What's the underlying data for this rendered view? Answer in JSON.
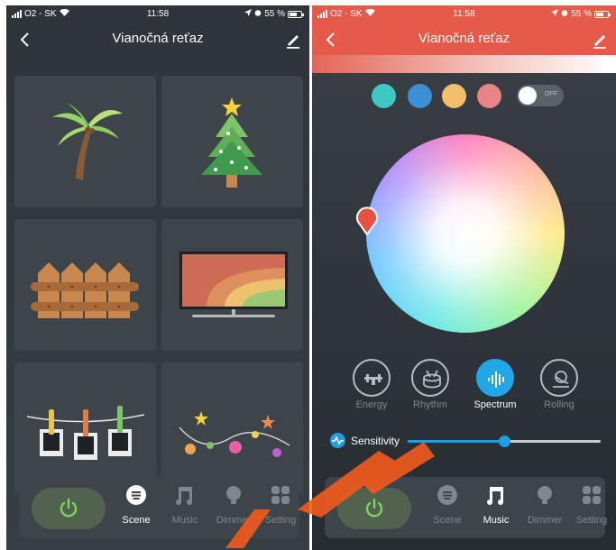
{
  "left_screen": {
    "status": {
      "carrier": "O2 - SK",
      "time": "11:58",
      "battery": "55 %"
    },
    "nav": {
      "title": "Vianočná reťaz"
    },
    "scenes": [
      {
        "icon": "palm-tree-icon"
      },
      {
        "icon": "christmas-tree-icon"
      },
      {
        "icon": "fence-icon"
      },
      {
        "icon": "tv-rainbow-icon"
      },
      {
        "icon": "photo-clothesline-icon"
      },
      {
        "icon": "string-lights-icon"
      }
    ],
    "bottom_tabs": [
      {
        "label": "Scene",
        "icon": "scene-icon",
        "active": true
      },
      {
        "label": "Music",
        "icon": "music-icon",
        "active": false
      },
      {
        "label": "Dimmer",
        "icon": "bulb-icon",
        "active": false
      },
      {
        "label": "Setting",
        "icon": "setting-icon",
        "active": false
      }
    ]
  },
  "right_screen": {
    "status": {
      "carrier": "O2 - SK",
      "time": "11:58",
      "battery": "55 %"
    },
    "nav": {
      "title": "Vianočná reťaz"
    },
    "swatches": [
      "#3ec8c3",
      "#3b8fd6",
      "#f2c06a",
      "#ea8383"
    ],
    "toggle": {
      "label": "OFF",
      "state": "off"
    },
    "modes": [
      {
        "label": "Energy",
        "icon": "energy-icon",
        "active": false
      },
      {
        "label": "Rhythm",
        "icon": "drum-icon",
        "active": false
      },
      {
        "label": "Spectrum",
        "icon": "spectrum-icon",
        "active": true
      },
      {
        "label": "Rolling",
        "icon": "rolling-icon",
        "active": false
      }
    ],
    "sensitivity": {
      "label": "Sensitivity",
      "value": 0.5
    },
    "bottom_tabs": [
      {
        "label": "Scene",
        "icon": "scene-icon",
        "active": false
      },
      {
        "label": "Music",
        "icon": "music-icon",
        "active": true
      },
      {
        "label": "Dimmer",
        "icon": "bulb-icon",
        "active": false
      },
      {
        "label": "Setting",
        "icon": "setting-icon",
        "active": false
      }
    ]
  },
  "colors": {
    "accent_blue": "#1f9fe3",
    "header_red": "#e55a49",
    "power_green": "#7fd35b"
  }
}
